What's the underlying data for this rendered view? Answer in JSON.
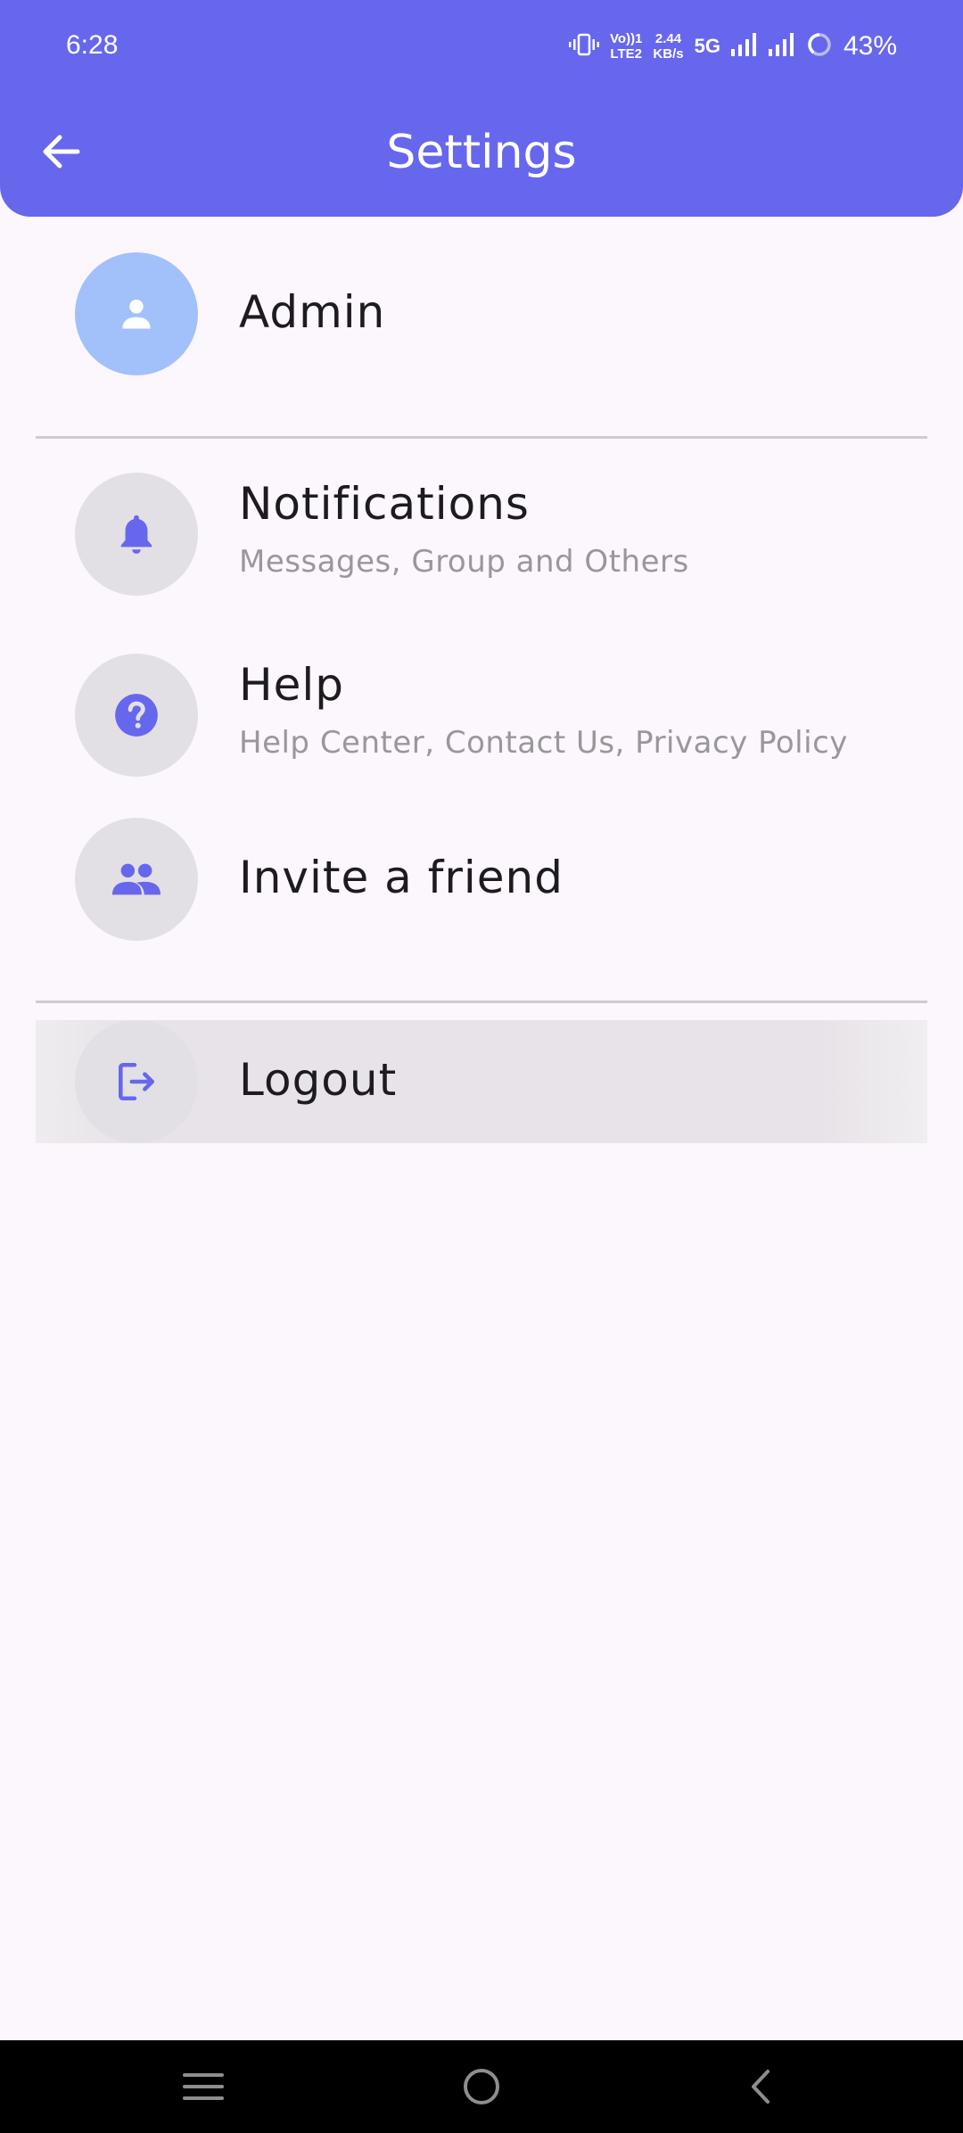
{
  "status_bar": {
    "time": "6:28",
    "volte_top": "Vo))1",
    "volte_bottom": "LTE2",
    "speed_value": "2.44",
    "speed_unit": "KB/s",
    "network": "5G",
    "battery": "43%"
  },
  "header": {
    "title": "Settings",
    "back_icon": "arrow-left-icon",
    "color": "#6767ED"
  },
  "profile": {
    "name": "Admin",
    "icon": "person-icon",
    "avatar_color": "#A2C1FB"
  },
  "menu": [
    {
      "title": "Notifications",
      "subtitle": "Messages, Group and Others",
      "icon": "bell-icon"
    },
    {
      "title": "Help",
      "subtitle": "Help Center, Contact Us, Privacy Policy",
      "icon": "help-circle-icon"
    },
    {
      "title": "Invite a friend",
      "icon": "group-icon"
    }
  ],
  "logout": {
    "title": "Logout",
    "icon": "logout-icon"
  },
  "nav_bar": {
    "icons": [
      "menu-icon",
      "home-circle-icon",
      "back-chevron-icon"
    ]
  },
  "colors": {
    "accent": "#6767ED",
    "background": "#FCF6FD",
    "icon_circle": "#E2E0E4",
    "subtitle": "#9A979B"
  }
}
